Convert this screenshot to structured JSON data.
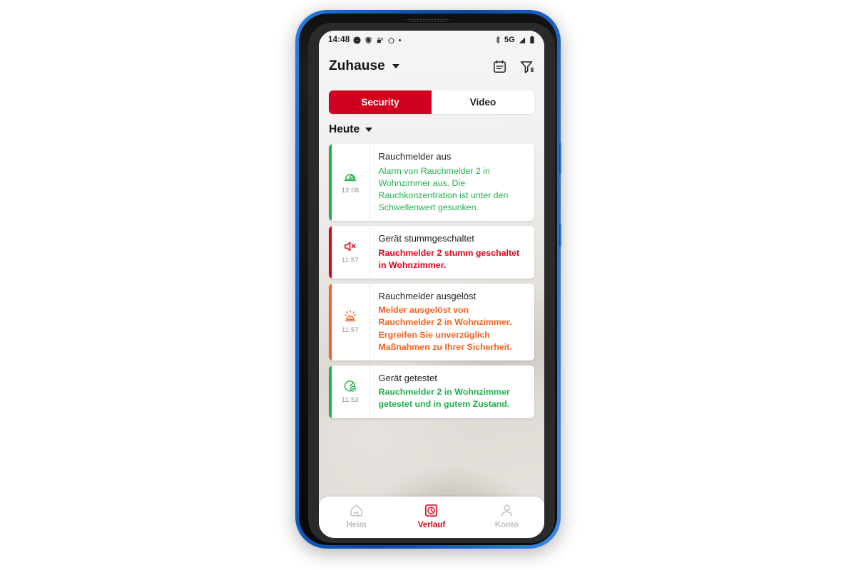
{
  "device": {
    "frame_color": "#0d47a1",
    "bezel_color": "#101010"
  },
  "status_bar": {
    "time": "14:48",
    "left_icons": [
      "messenger-icon",
      "shield-icon",
      "lock-nfc-icon",
      "home-assistant-icon",
      "more-dot-icon"
    ],
    "right_icons": [
      "bluetooth-icon",
      "network-label",
      "signal-icon",
      "battery-icon"
    ],
    "network_label": "5G"
  },
  "app_bar": {
    "title": "Zuhause",
    "dropdown_icon": "chevron-down-icon",
    "actions": [
      {
        "name": "calendar-icon",
        "label": "Kalender"
      },
      {
        "name": "filter-icon",
        "label": "Filter"
      }
    ]
  },
  "segmented_control": {
    "active_index": 0,
    "active_color": "#d2001f",
    "tabs": [
      {
        "label": "Security",
        "active": true
      },
      {
        "label": "Video",
        "active": false
      }
    ]
  },
  "day_selector": {
    "label": "Heute",
    "dropdown_icon": "chevron-down-icon"
  },
  "events": [
    {
      "time": "12:06",
      "title": "Rauchmelder aus",
      "description": "Alarm von Rauchmelder 2 in Wohnzimmer aus. Die Rauchkonzentration ist unter den Schwellenwert gesunken.",
      "icon": "smoke-detector-ok-icon",
      "accent_color": "#22b04f",
      "text_color": "#22b04f"
    },
    {
      "time": "11:57",
      "title": "Gerät stummgeschaltet",
      "description": "Rauchmelder 2 stumm geschaltet in Wohnzimmer.",
      "icon": "speaker-muted-icon",
      "accent_color": "#e2001a",
      "text_color": "#e2001a"
    },
    {
      "time": "11:57",
      "title": "Rauchmelder ausgelöst",
      "description": "Melder ausgelöst von Rauchmelder 2 in Wohnzimmer. Ergreifen Sie unverzüglich Maßnahmen zu Ihrer Sicherheit.",
      "icon": "siren-alarm-icon",
      "accent_color": "#f4621f",
      "text_color": "#f4621f"
    },
    {
      "time": "11:53",
      "title": "Gerät getestet",
      "description": "Rauchmelder 2 in Wohnzimmer getestet und in gutem Zustand.",
      "icon": "test-check-icon",
      "accent_color": "#22b04f",
      "text_color": "#22b04f"
    }
  ],
  "bottom_nav": {
    "active_index": 1,
    "active_color": "#e2001a",
    "inactive_color": "#bdbdbd",
    "items": [
      {
        "label": "Heim",
        "icon": "home-icon",
        "active": false
      },
      {
        "label": "Verlauf",
        "icon": "history-icon",
        "active": true
      },
      {
        "label": "Konto",
        "icon": "account-icon",
        "active": false
      }
    ]
  }
}
